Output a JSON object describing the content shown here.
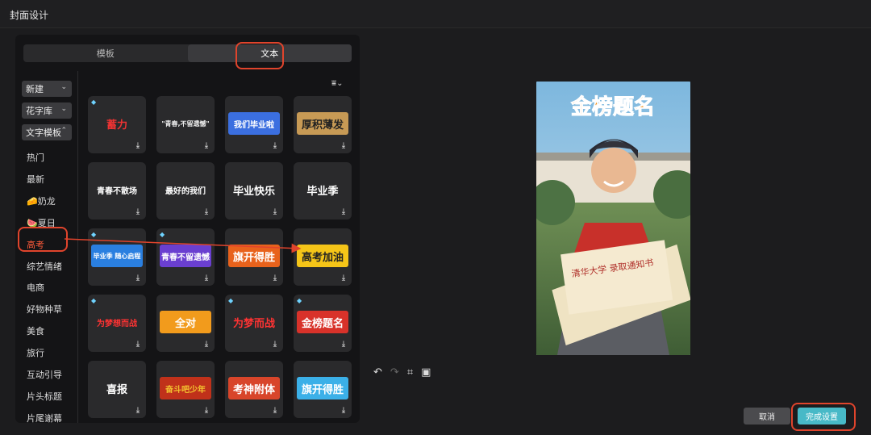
{
  "window": {
    "title": "封面设计"
  },
  "tabs": [
    {
      "label": "模板",
      "active": false
    },
    {
      "label": "文本",
      "active": true
    }
  ],
  "sidebar": {
    "dropdowns": [
      "新建",
      "花字库",
      "文字模板"
    ],
    "items": [
      {
        "label": "热门"
      },
      {
        "label": "最新"
      },
      {
        "label": "奶龙",
        "emoji": "🧀"
      },
      {
        "label": "夏日",
        "emoji": "🍉"
      },
      {
        "label": "高考",
        "active": true
      },
      {
        "label": "综艺情绪"
      },
      {
        "label": "电商"
      },
      {
        "label": "好物种草"
      },
      {
        "label": "美食"
      },
      {
        "label": "旅行"
      },
      {
        "label": "互动引导"
      },
      {
        "label": "片头标题"
      },
      {
        "label": "片尾谢幕"
      }
    ]
  },
  "filter": {
    "label": "⏷"
  },
  "templates": [
    {
      "text": "蓄力",
      "color": "#e33",
      "gem": true
    },
    {
      "text": "\"青春,不留遗憾\"",
      "color": "#eee",
      "gem": false
    },
    {
      "text": "我们毕业啦",
      "color": "#fff",
      "bg": "#3b6fe0",
      "gem": false
    },
    {
      "text": "厚积薄发",
      "color": "#222",
      "bg": "#c79a55",
      "gem": false
    },
    {
      "text": "青春不散场",
      "color": "#fff",
      "gem": false
    },
    {
      "text": "最好的我们",
      "color": "#fff",
      "gem": false
    },
    {
      "text": "毕业快乐",
      "color": "#fff",
      "gem": false
    },
    {
      "text": "毕业季",
      "color": "#fff",
      "gem": false
    },
    {
      "text": "毕业季 随心启程",
      "color": "#fff",
      "bg": "#2a7fe0",
      "gem": true
    },
    {
      "text": "青春不留遗憾",
      "color": "#fff",
      "bg": "#6a3fd0",
      "gem": true
    },
    {
      "text": "旗开得胜",
      "color": "#fff",
      "bg": "#e8621c",
      "gem": false
    },
    {
      "text": "高考加油",
      "color": "#222",
      "bg": "#f5c518",
      "gem": false
    },
    {
      "text": "为梦想而战",
      "color": "#f33",
      "gem": true
    },
    {
      "text": "全对",
      "color": "#fff",
      "bg": "#f29b1c",
      "gem": false
    },
    {
      "text": "为梦而战",
      "color": "#f33",
      "gem": true
    },
    {
      "text": "金榜题名",
      "color": "#fff",
      "bg": "#d8322a",
      "gem": true
    },
    {
      "text": "喜报",
      "color": "#fff",
      "gem": false
    },
    {
      "text": "奋斗吧少年",
      "color": "#f4c430",
      "bg": "#c0311a",
      "gem": false
    },
    {
      "text": "考神附体",
      "color": "#fff",
      "bg": "#d8452a",
      "gem": false
    },
    {
      "text": "旗开得胜",
      "color": "#fff",
      "bg": "#3bb0e8",
      "gem": false
    }
  ],
  "preview": {
    "headline": "金榜题名",
    "letter_text": "清华大学 录取通知书"
  },
  "tools": {
    "undo": "undo-icon",
    "redo": "redo-icon",
    "crop": "crop-icon",
    "image": "image-icon"
  },
  "buttons": {
    "cancel": "取消",
    "confirm": "完成设置"
  },
  "colors": {
    "accent": "#48b9c7",
    "highlight": "#e0442c",
    "active_item": "#ff5b3a"
  }
}
